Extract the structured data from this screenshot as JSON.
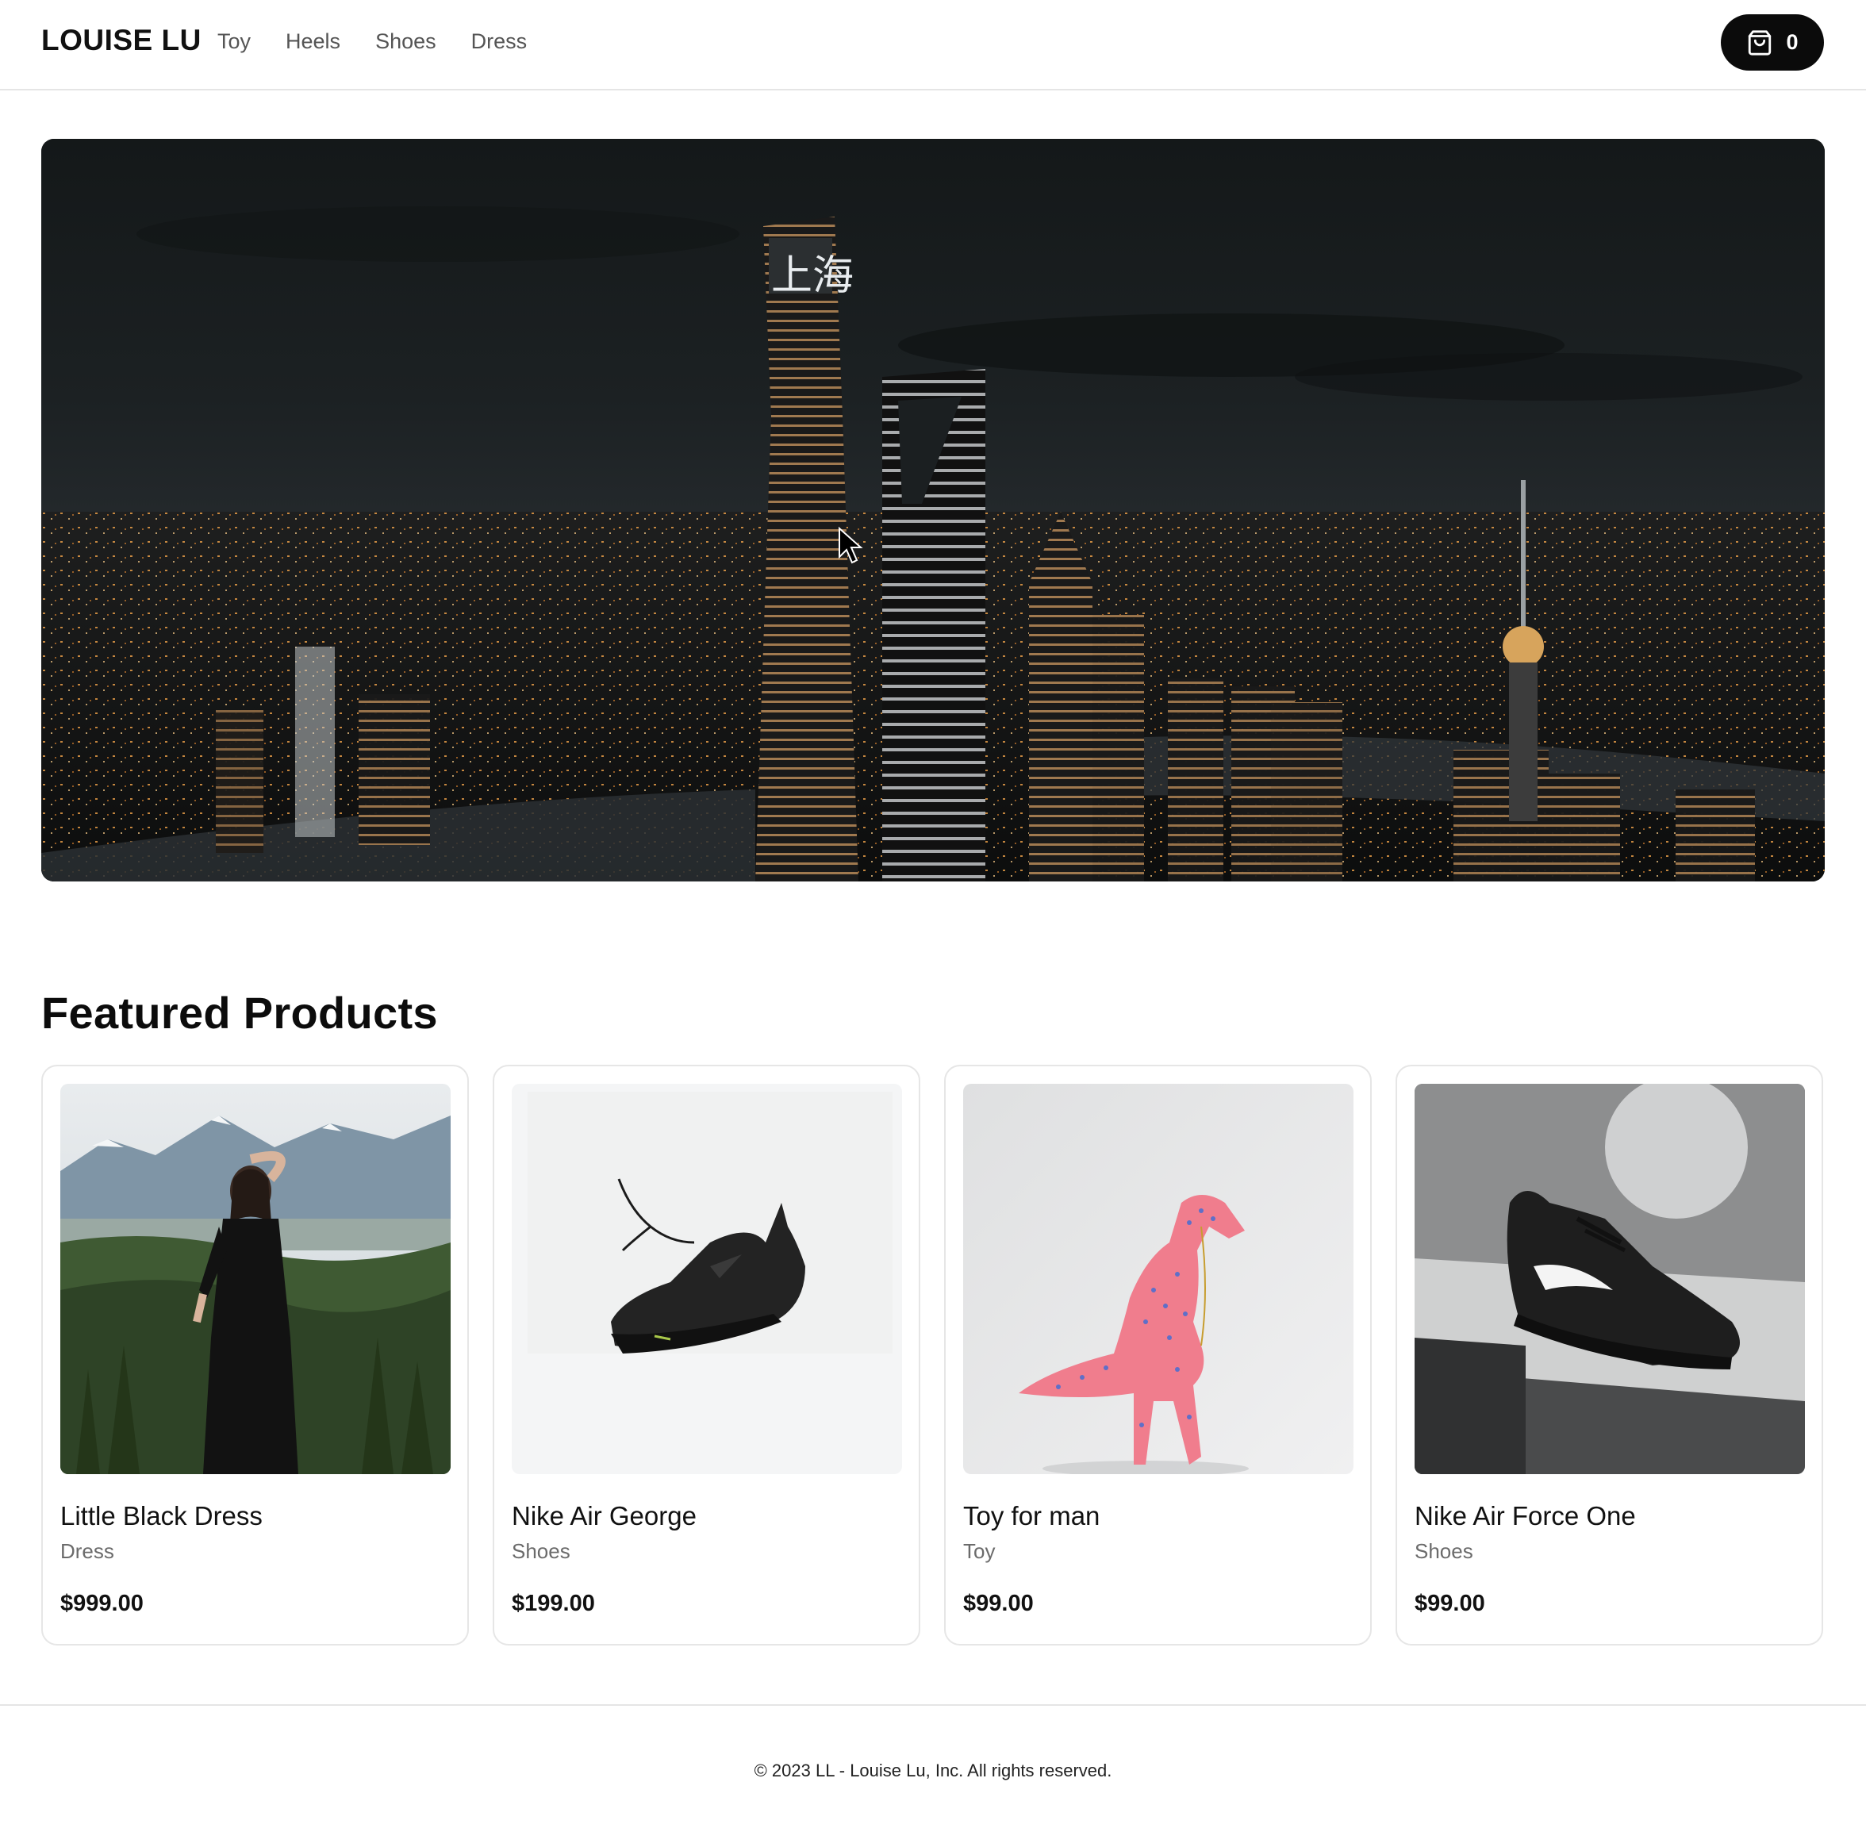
{
  "header": {
    "brand": "LOUISE LU",
    "nav": [
      {
        "label": "Toy"
      },
      {
        "label": "Heels"
      },
      {
        "label": "Shoes"
      },
      {
        "label": "Dress"
      }
    ],
    "cart": {
      "icon": "shopping-bag-icon",
      "count": "0"
    }
  },
  "hero": {
    "image": "city-night-skyline",
    "sign_text": "上海"
  },
  "featured": {
    "title": "Featured Products",
    "products": [
      {
        "name": "Little Black Dress",
        "category": "Dress",
        "price": "$999.00",
        "image": "woman-black-dress-mountains"
      },
      {
        "name": "Nike Air George",
        "category": "Shoes",
        "price": "$199.00",
        "image": "black-sneaker-floating"
      },
      {
        "name": "Toy for man",
        "category": "Toy",
        "price": "$99.00",
        "image": "pink-dinosaur-toy"
      },
      {
        "name": "Nike Air Force One",
        "category": "Shoes",
        "price": "$99.00",
        "image": "black-sneaker-on-shelf"
      }
    ]
  },
  "footer": {
    "text": "© 2023 LL - Louise Lu, Inc. All rights reserved."
  },
  "colors": {
    "background": "#ffffff",
    "text": "#111111",
    "muted": "#6b6b6b",
    "border": "#e5e5e5",
    "cart_button": "#0b0b0b",
    "city_light": "#f0a24a"
  }
}
